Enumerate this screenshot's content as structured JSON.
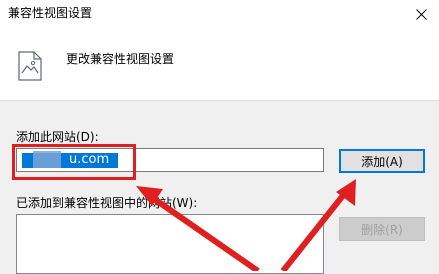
{
  "window": {
    "title": "兼容性视图设置"
  },
  "header": {
    "title": "更改兼容性视图设置",
    "icon": "document-picture-icon"
  },
  "add_site": {
    "label": "添加此网站(D):",
    "value": "u.com",
    "button_label": "添加(A)"
  },
  "added_sites": {
    "label": "已添加到兼容性视图中的网站(W):",
    "items": [],
    "remove_button_label": "删除(R)"
  },
  "annotation": {
    "highlight_color": "#e02020"
  }
}
